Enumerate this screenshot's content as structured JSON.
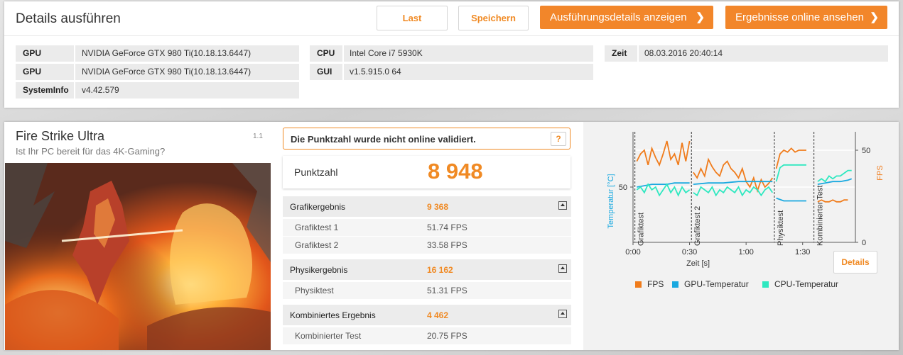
{
  "header": {
    "title": "Details ausführen",
    "buttons": {
      "last": "Last",
      "save": "Speichern",
      "show_details": "Ausführungsdetails anzeigen",
      "view_online": "Ergebnisse online ansehen"
    },
    "chevron": "❯"
  },
  "system_info": {
    "col1": [
      {
        "key": "GPU",
        "value": "NVIDIA GeForce GTX 980 Ti(10.18.13.6447)"
      },
      {
        "key": "GPU",
        "value": "NVIDIA GeForce GTX 980 Ti(10.18.13.6447)"
      },
      {
        "key": "SystemInfo",
        "value": "v4.42.579"
      }
    ],
    "col2": [
      {
        "key": "CPU",
        "value": "Intel Core i7 5930K"
      },
      {
        "key": "GUI",
        "value": "v1.5.915.0 64"
      }
    ],
    "col3": [
      {
        "key": "Zeit",
        "value": "08.03.2016 20:40:14"
      }
    ]
  },
  "test": {
    "title": "Fire Strike Ultra",
    "subtitle": "Ist Ihr PC bereit für das 4K-Gaming?",
    "version": "1.1",
    "warning": "Die Punktzahl wurde nicht online validiert.",
    "help": "?",
    "score_label": "Punktzahl",
    "score_value": "8 948"
  },
  "results": [
    {
      "label": "Grafikergebnis",
      "value": "9 368",
      "subtests": [
        {
          "label": "Grafiktest 1",
          "value": "51.74 FPS"
        },
        {
          "label": "Grafiktest 2",
          "value": "33.58 FPS"
        }
      ]
    },
    {
      "label": "Physikergebnis",
      "value": "16 162",
      "subtests": [
        {
          "label": "Physiktest",
          "value": "51.31 FPS"
        }
      ]
    },
    {
      "label": "Kombiniertes Ergebnis",
      "value": "4 462",
      "subtests": [
        {
          "label": "Kombinierter Test",
          "value": "20.75 FPS"
        }
      ]
    }
  ],
  "details_button": "Details",
  "colors": {
    "accent": "#f08a24",
    "fps": "#f07c1c",
    "gpu_temp": "#1aa9e0",
    "cpu_temp": "#2ee8c0"
  },
  "chart_data": {
    "type": "line",
    "xlabel": "Zeit [s]",
    "ylabel_left": "Temperatur [°C]",
    "ylabel_right": "FPS",
    "x_ticks": [
      "0:00",
      "0:30",
      "1:00",
      "1:30"
    ],
    "y_left_ticks": [
      "50"
    ],
    "y_right_ticks": [
      "0",
      "50"
    ],
    "xlim": [
      0,
      118
    ],
    "ylim_fps": [
      0,
      60
    ],
    "ylim_temp": [
      30,
      70
    ],
    "sections": [
      {
        "label": "Grafiktest",
        "start": 1
      },
      {
        "label": "Grafiktest 2",
        "start": 31
      },
      {
        "label": "Physiktest",
        "start": 75
      },
      {
        "label": "Kombinierter Test",
        "start": 96
      }
    ],
    "series": [
      {
        "name": "FPS",
        "color": "#f07c1c",
        "segments": [
          {
            "x": [
              2,
              4,
              6,
              8,
              10,
              12,
              14,
              16,
              18,
              20,
              22,
              24,
              26,
              28,
              30
            ],
            "y": [
              44,
              48,
              50,
              42,
              51,
              46,
              42,
              48,
              55,
              45,
              48,
              42,
              54,
              44,
              55
            ]
          },
          {
            "x": [
              32,
              34,
              36,
              38,
              40,
              42,
              44,
              46,
              48,
              50,
              52,
              54,
              56,
              58,
              60,
              62,
              64,
              66,
              68,
              70,
              72,
              74
            ],
            "y": [
              38,
              35,
              40,
              36,
              45,
              41,
              38,
              36,
              42,
              44,
              40,
              38,
              35,
              40,
              33,
              30,
              35,
              28,
              34,
              30,
              32,
              35
            ]
          },
          {
            "x": [
              76,
              78,
              80,
              82,
              84,
              86,
              88,
              90,
              92
            ],
            "y": [
              40,
              48,
              50,
              49,
              51,
              49,
              50,
              50,
              50
            ]
          },
          {
            "x": [
              98,
              100,
              102,
              104,
              106,
              108,
              110,
              112,
              114
            ],
            "y": [
              22,
              23,
              22,
              22,
              23,
              22,
              22,
              23,
              23
            ]
          }
        ]
      },
      {
        "name": "GPU-Temperatur",
        "color": "#1aa9e0",
        "segments": [
          {
            "x": [
              2,
              6,
              10,
              14,
              18,
              22,
              26,
              30
            ],
            "y": [
              50,
              50.5,
              51,
              51,
              51,
              51.5,
              51.5,
              51.5
            ]
          },
          {
            "x": [
              32,
              40,
              48,
              56,
              64,
              72,
              74
            ],
            "y": [
              51,
              51.5,
              51.5,
              52,
              52,
              52,
              52
            ]
          },
          {
            "x": [
              76,
              80,
              84,
              88,
              92
            ],
            "y": [
              46,
              45,
              45,
              45,
              45
            ]
          },
          {
            "x": [
              98,
              102,
              106,
              110,
              114,
              116
            ],
            "y": [
              51,
              51.5,
              52,
              52,
              52.5,
              53
            ]
          }
        ]
      },
      {
        "name": "CPU-Temperatur",
        "color": "#2ee8c0",
        "segments": [
          {
            "x": [
              2,
              4,
              6,
              8,
              10,
              12,
              14,
              16,
              18,
              20,
              22,
              24,
              26,
              28,
              30
            ],
            "y": [
              49,
              50,
              48,
              51,
              49,
              50,
              47,
              49,
              51,
              48,
              50,
              47,
              50,
              48,
              49
            ]
          },
          {
            "x": [
              32,
              34,
              36,
              38,
              40,
              42,
              44,
              46,
              48,
              50,
              52,
              54,
              56,
              58,
              60,
              62,
              64,
              66,
              68,
              70,
              72,
              74
            ],
            "y": [
              48,
              47,
              50,
              49,
              48,
              50,
              47,
              49,
              48,
              50,
              49,
              48,
              50,
              47,
              49,
              48,
              50,
              49,
              47,
              49,
              50,
              48
            ]
          },
          {
            "x": [
              76,
              78,
              80,
              82,
              84,
              86,
              88,
              90,
              92
            ],
            "y": [
              52,
              57,
              58,
              58,
              58,
              58,
              58,
              58,
              58
            ]
          },
          {
            "x": [
              98,
              100,
              102,
              104,
              106,
              108,
              110,
              112,
              114,
              116
            ],
            "y": [
              52,
              53,
              52,
              54,
              53,
              54,
              54,
              55,
              56,
              56
            ]
          }
        ]
      }
    ],
    "legend": [
      "FPS",
      "GPU-Temperatur",
      "CPU-Temperatur"
    ]
  }
}
